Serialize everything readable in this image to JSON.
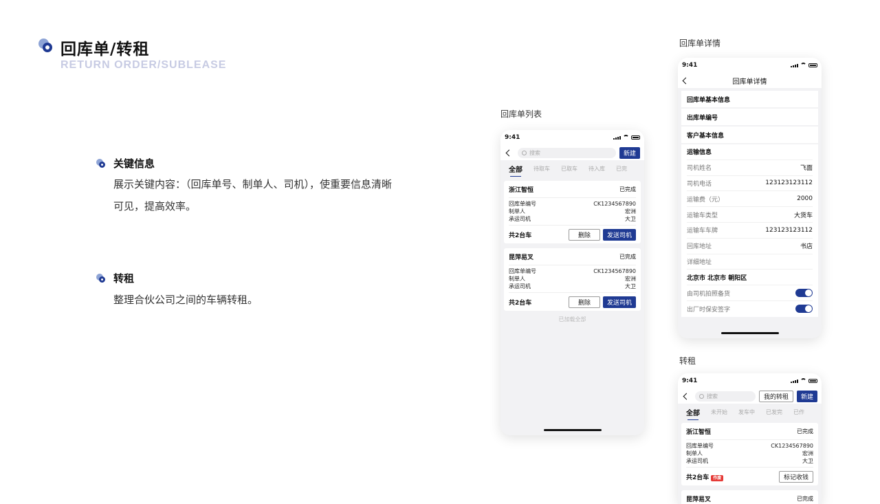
{
  "header": {
    "title": "回库单/转租",
    "subtitle": "RETURN ORDER/SUBLEASE"
  },
  "sections": [
    {
      "title": "关键信息",
      "line1": "展示关键内容：（回库单号、制单人、司机），使重要信息清晰",
      "line2": "可见，提高效率。"
    },
    {
      "title": "转租",
      "line1": "整理合伙公司之间的车辆转租。"
    }
  ],
  "captions": {
    "list": "回库单列表",
    "detail": "回库单详情",
    "sublease": "转租"
  },
  "status_time": "9:41",
  "list_phone": {
    "search_placeholder": "搜索",
    "new_button": "新建",
    "tabs": [
      "全部",
      "待取车",
      "已取车",
      "待入库",
      "已完"
    ],
    "cards": [
      {
        "name": "浙江智恒",
        "status": "已完成",
        "rows": [
          {
            "k": "回库单编号",
            "v": "CK1234567890"
          },
          {
            "k": "制单人",
            "v": "宏洲"
          },
          {
            "k": "承运司机",
            "v": "大卫"
          }
        ],
        "total": "共2台车",
        "btn1": "删除",
        "btn2": "发送司机"
      },
      {
        "name": "昆萍易叉",
        "status": "已完成",
        "rows": [
          {
            "k": "回库单编号",
            "v": "CK1234567890"
          },
          {
            "k": "制单人",
            "v": "宏洲"
          },
          {
            "k": "承运司机",
            "v": "大卫"
          }
        ],
        "total": "共2台车",
        "btn1": "删除",
        "btn2": "发送司机"
      }
    ],
    "loaded_text": "已加载全部"
  },
  "detail_phone": {
    "title": "回库单详情",
    "sections": [
      "回库单基本信息",
      "出库单编号",
      "客户基本信息"
    ],
    "transport": {
      "head": "运输信息",
      "rows": [
        {
          "k": "司机姓名",
          "v": "飞面"
        },
        {
          "k": "司机电话",
          "v": "123123123112"
        },
        {
          "k": "运输费（元）",
          "v": "2000"
        },
        {
          "k": "运输车类型",
          "v": "大货车"
        },
        {
          "k": "运输车车牌",
          "v": "123123123112"
        },
        {
          "k": "回库地址",
          "v": "书店"
        },
        {
          "k": "详细地址",
          "v": ""
        }
      ],
      "address": "北京市  北京市  朝阳区",
      "toggles": [
        {
          "k": "由司机拍照备货",
          "on": true
        },
        {
          "k": "出厂时保安签字",
          "on": true
        }
      ]
    }
  },
  "sublease_phone": {
    "search_placeholder": "搜索",
    "my_button": "我的转租",
    "new_button": "新建",
    "tabs": [
      "全部",
      "未开始",
      "发车中",
      "已发完",
      "已作"
    ],
    "card": {
      "name": "浙江智恒",
      "status": "已完成",
      "rows": [
        {
          "k": "回库单编号",
          "v": "CK1234567890"
        },
        {
          "k": "制单人",
          "v": "宏洲"
        },
        {
          "k": "承运司机",
          "v": "大卫"
        }
      ],
      "total": "共2台车",
      "badge": "作废",
      "action": "标记收钱"
    },
    "next_card": {
      "name": "昆萍易叉",
      "status": "已完成"
    }
  }
}
